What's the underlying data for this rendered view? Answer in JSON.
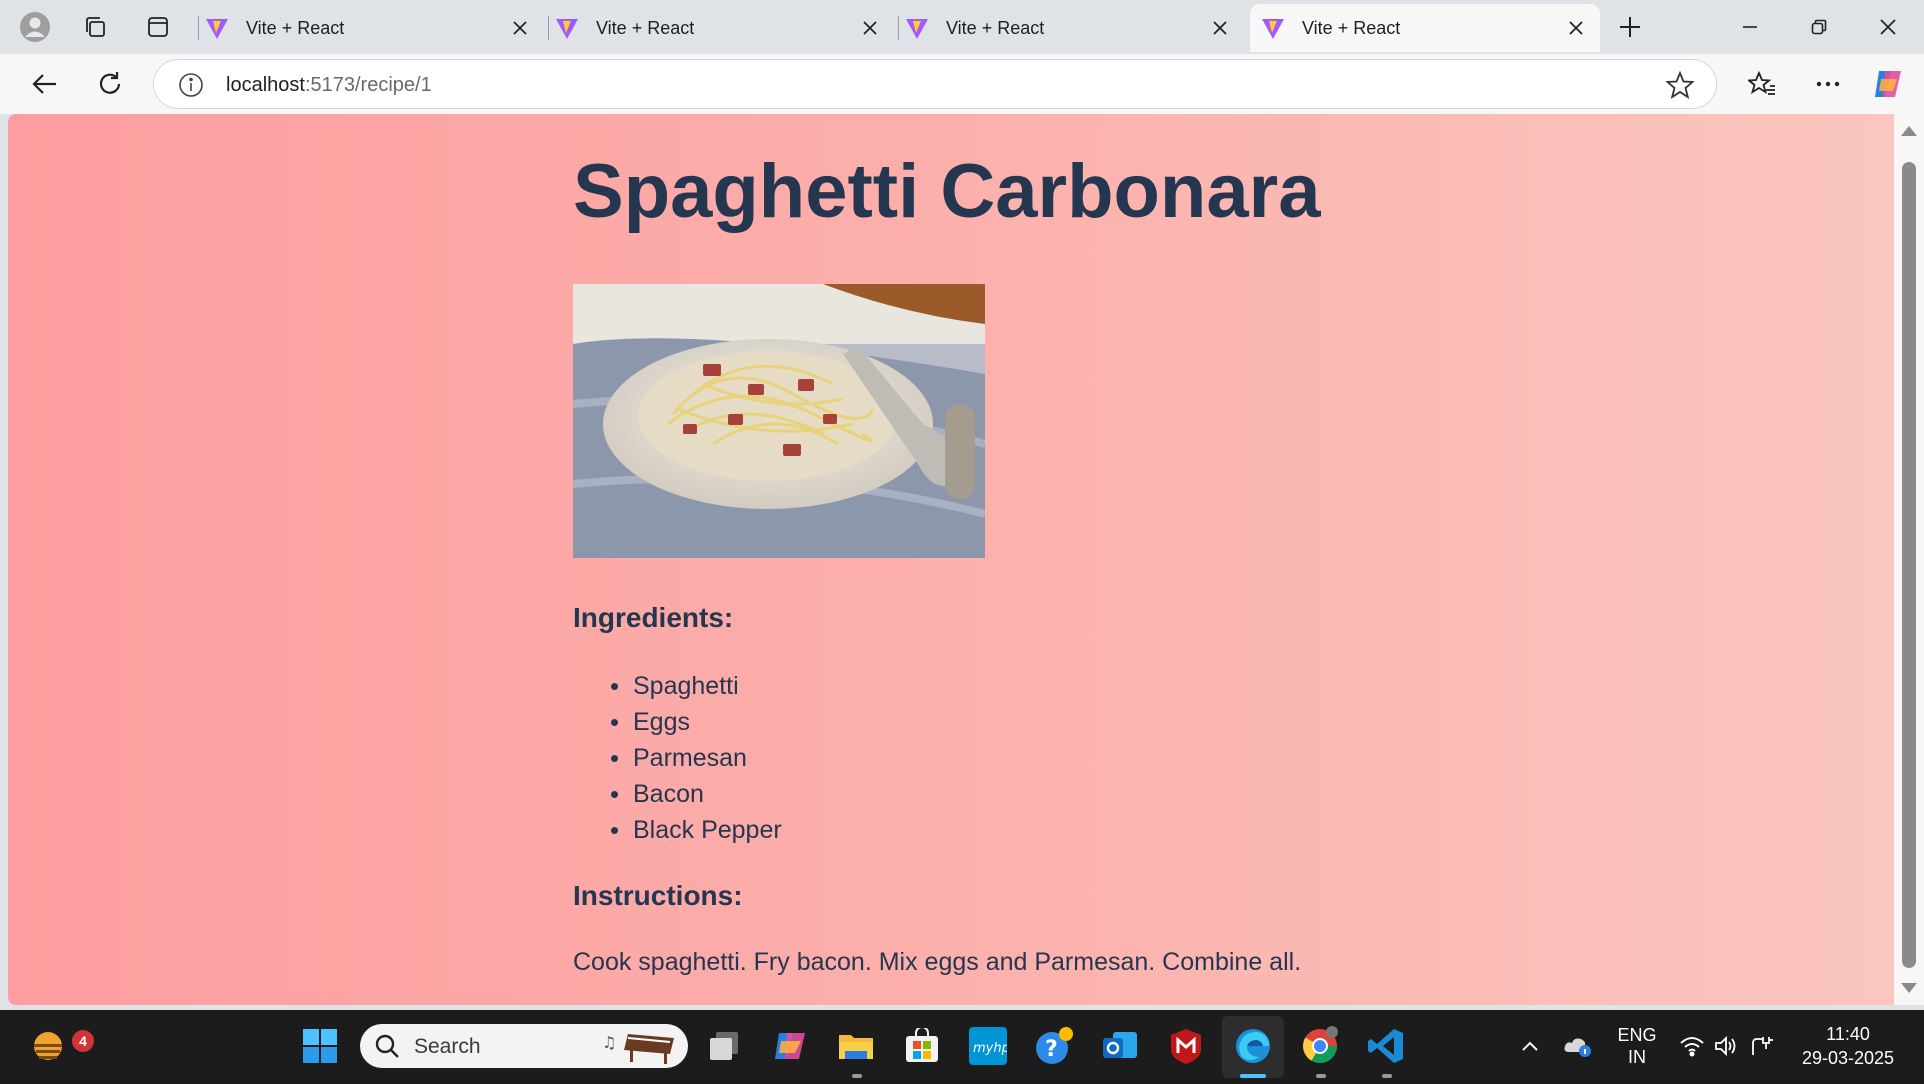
{
  "browser": {
    "tabs": [
      {
        "title": "Vite + React"
      },
      {
        "title": "Vite + React"
      },
      {
        "title": "Vite + React"
      },
      {
        "title": "Vite + React"
      }
    ],
    "address": {
      "host": "localhost",
      "path": ":5173/recipe/1"
    }
  },
  "page": {
    "title": "Spaghetti Carbonara",
    "image_alt": "Spaghetti Carbonara",
    "ingredients_heading": "Ingredients:",
    "ingredients": [
      "Spaghetti",
      "Eggs",
      "Parmesan",
      "Bacon",
      "Black Pepper"
    ],
    "instructions_heading": "Instructions:",
    "instructions": "Cook spaghetti. Fry bacon. Mix eggs and Parmesan. Combine all.",
    "background_gradient": [
      "#fd9d9f",
      "#fac6bf"
    ],
    "text_color": "#253650"
  },
  "taskbar": {
    "weather_badge": "4",
    "search_placeholder": "Search",
    "language": "ENG",
    "region": "IN",
    "time": "11:40",
    "date": "29-03-2025",
    "pinned_icons": [
      "start-icon",
      "search-icon",
      "task-view-icon",
      "copilot-icon",
      "file-explorer-icon",
      "store-icon",
      "myhp-icon",
      "help-icon",
      "outlook-icon",
      "mcafee-icon",
      "edge-icon",
      "chrome-icon",
      "vscode-icon"
    ]
  }
}
